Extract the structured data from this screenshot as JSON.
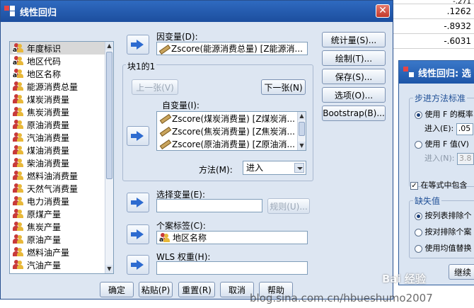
{
  "sheet": {
    "values": [
      "-.271",
      ".1262",
      "-.8932",
      "-.6031"
    ]
  },
  "dialog": {
    "title": "线性回归",
    "close_label": "✕",
    "variables": [
      {
        "label": "年度标识",
        "selected": true,
        "type": "nominal"
      },
      {
        "label": "地区代码",
        "type": "nominal"
      },
      {
        "label": "地区名称",
        "type": "nominal"
      },
      {
        "label": "能源消费总量",
        "type": "scale"
      },
      {
        "label": "煤炭消费量",
        "type": "scale"
      },
      {
        "label": "焦炭消费量",
        "type": "scale"
      },
      {
        "label": "原油消费量",
        "type": "scale"
      },
      {
        "label": "汽油消费量",
        "type": "scale"
      },
      {
        "label": "煤油消费量",
        "type": "scale"
      },
      {
        "label": "柴油消费量",
        "type": "scale"
      },
      {
        "label": "燃料油消费量",
        "type": "scale"
      },
      {
        "label": "天然气消费量",
        "type": "scale"
      },
      {
        "label": "电力消费量",
        "type": "scale"
      },
      {
        "label": "原煤产量",
        "type": "scale"
      },
      {
        "label": "焦炭产量",
        "type": "scale"
      },
      {
        "label": "原油产量",
        "type": "scale"
      },
      {
        "label": "燃料油产量",
        "type": "scale"
      },
      {
        "label": "汽油产量",
        "type": "scale"
      }
    ],
    "dependent_label": "因变量(D):",
    "dependent_value": "Zscore(能源消费总量) [Z能源消...",
    "block_label": "块1的1",
    "prev_button": "上一张(V)",
    "next_button": "下一张(N)",
    "independent_label": "自变量(I):",
    "independents": [
      "Zscore(煤炭消费量) [Z煤炭消...",
      "Zscore(焦炭消费量) [Z焦炭消...",
      "Zscore(原油消费量) [Z原油消..."
    ],
    "method_label": "方法(M):",
    "method_value": "进入",
    "selection_label": "选择变量(E):",
    "rule_button": "规则(U)...",
    "case_label_label": "个案标签(C):",
    "case_label_value": "地区名称",
    "wls_label": "WLS 权重(H):",
    "side_buttons": [
      "统计量(S)...",
      "绘制(T)...",
      "保存(S)...",
      "选项(O)...",
      "Bootstrap(B)..."
    ],
    "bottom_buttons": [
      "确定",
      "粘贴(P)",
      "重置(R)",
      "取消",
      "帮助"
    ]
  },
  "dialog2": {
    "title": "线性回归: 选",
    "step_group": "步进方法标准",
    "use_f_prob": "使用 F 的概率",
    "entry_label": "进入(E):",
    "entry_value": ".05",
    "use_f_value": "使用 F 值(V)",
    "entry2_label": "进入(N):",
    "entry2_value": "3.8",
    "include_const": "在等式中包含",
    "missing_group": "缺失值",
    "listwise": "按列表排除个",
    "pairwise": "按对排除个案",
    "mean_sub": "使用均值替换",
    "continue_button": "继续"
  },
  "watermark": {
    "text1": "Bai 经验",
    "text2": "blog.sina.com.cn/hbueshumo2007"
  }
}
